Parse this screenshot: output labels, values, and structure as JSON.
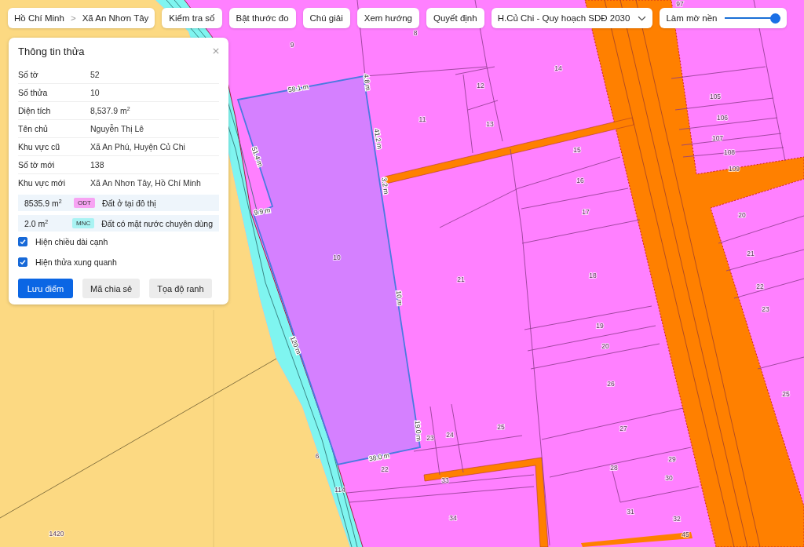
{
  "breadcrumb": {
    "items": [
      "Hồ Chí Minh",
      "Xã An Nhơn Tây"
    ],
    "separator": ">"
  },
  "toolbar_buttons": [
    "Kiểm tra số",
    "Bật thước đo",
    "Chú giải",
    "Xem hướng",
    "Quyết định"
  ],
  "plan_select": {
    "value": "H.Củ Chi - Quy hoạch SDĐ 2030"
  },
  "fade_control": {
    "label": "Làm mờ nền",
    "level": 1
  },
  "info_panel": {
    "title": "Thông tin thửa",
    "rows": [
      {
        "label": "Số tờ",
        "value": "52"
      },
      {
        "label": "Số thửa",
        "value": "10"
      },
      {
        "label": "Diện tích",
        "value": "8,537.9 m$^{2}$"
      },
      {
        "label": "Tên chủ",
        "value": "Nguyễn Thị Lê"
      },
      {
        "label": "Khu vực cũ",
        "value": "Xã An Phú, Huyện Củ Chi"
      },
      {
        "label": "Số tờ mới",
        "value": "138"
      },
      {
        "label": "Khu vực mới",
        "value": "Xã An Nhơn Tây, Hồ Chí Minh"
      }
    ],
    "land_uses": [
      {
        "area": "8535.9 m$^{2}$",
        "code": "ODT",
        "color": "#f7a3f3",
        "description": "Đất ở tại đô thị"
      },
      {
        "area": "2.0 m$^{2}$",
        "code": "MNC",
        "color": "#a9f3f3",
        "description": "Đất có mặt nước chuyên dùng"
      }
    ],
    "options": [
      {
        "label": "Hiện chiều dài cạnh",
        "checked": true
      },
      {
        "label": "Hiện thửa xung quanh",
        "checked": true
      }
    ],
    "buttons": [
      {
        "label": "Lưu điểm",
        "kind": "primary"
      },
      {
        "label": "Mã chia sẻ",
        "kind": "secondary"
      },
      {
        "label": "Tọa độ ranh",
        "kind": "secondary"
      }
    ]
  },
  "map": {
    "parcel_labels": [
      "9",
      "97",
      "8",
      "14",
      "12",
      "13",
      "11",
      "105",
      "106",
      "107",
      "108",
      "109",
      "15",
      "16",
      "17",
      "20",
      "21",
      "21",
      "18",
      "22",
      "23",
      "19",
      "20",
      "26",
      "25",
      "25",
      "27",
      "24",
      "23",
      "10",
      "22",
      "6",
      "114",
      "33",
      "29",
      "28",
      "30",
      "34",
      "31",
      "32",
      "45",
      "1420"
    ],
    "edge_labels": [
      "58.1 m",
      "4.8 m",
      "41.2 m",
      "51.4 m",
      "3.2 m",
      "9.9 m",
      "10 m",
      "120 m",
      "19.0 m",
      "38.0 m"
    ]
  }
}
